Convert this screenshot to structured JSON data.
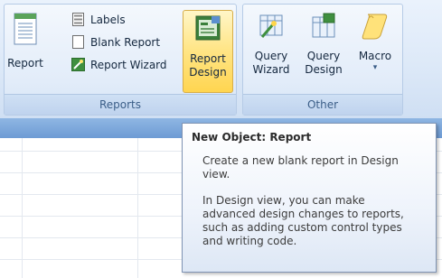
{
  "ribbon": {
    "reports_group": {
      "label": "Reports",
      "report_button": "Report",
      "labels_button": "Labels",
      "blank_report_button": "Blank Report",
      "report_wizard_button": "Report Wizard",
      "report_design_button_line1": "Report",
      "report_design_button_line2": "Design"
    },
    "other_group": {
      "label": "Other",
      "query_wizard_line1": "Query",
      "query_wizard_line2": "Wizard",
      "query_design_line1": "Query",
      "query_design_line2": "Design",
      "macro_button": "Macro",
      "macro_dropdown": "▾"
    }
  },
  "tooltip": {
    "title": "New Object: Report",
    "paragraph1": "Create a new blank report in Design view.",
    "paragraph2": "In Design view, you can make advanced design changes to reports, such as adding custom control types and writing code."
  },
  "icons": {
    "report": "report-icon",
    "labels": "labels-icon",
    "blank_report": "blank-report-icon",
    "report_wizard": "report-wizard-icon",
    "report_design": "report-design-icon",
    "query_wizard": "query-wizard-icon",
    "query_design": "query-design-icon",
    "macro": "macro-scroll-icon"
  },
  "colors": {
    "ribbon_bg": "#dde9f8",
    "highlight": "#ffd550",
    "tooltip_border": "#7f93b3",
    "header_bar": "#7fa8dc"
  }
}
